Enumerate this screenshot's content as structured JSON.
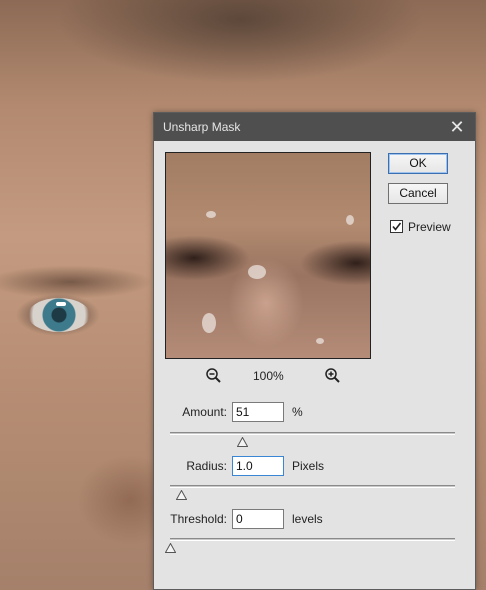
{
  "dialog": {
    "title": "Unsharp Mask",
    "ok_label": "OK",
    "cancel_label": "Cancel",
    "preview_label": "Preview",
    "preview_checked": true,
    "zoom_level": "100%",
    "amount": {
      "label": "Amount:",
      "value": "51",
      "unit": "%",
      "slider_fraction": 0.255
    },
    "radius": {
      "label": "Radius:",
      "value": "1.0",
      "unit": "Pixels",
      "slider_fraction": 0.04
    },
    "threshold": {
      "label": "Threshold:",
      "value": "0",
      "unit": "levels",
      "slider_fraction": 0.0
    }
  },
  "icons": {
    "close": "close-icon",
    "zoom_out": "zoom-out-icon",
    "zoom_in": "zoom-in-icon",
    "check": "checkmark-icon"
  },
  "colors": {
    "titlebar": "#4f4f4f",
    "dialog_bg": "#e3e3e3",
    "active_field": "#3b86d4"
  }
}
